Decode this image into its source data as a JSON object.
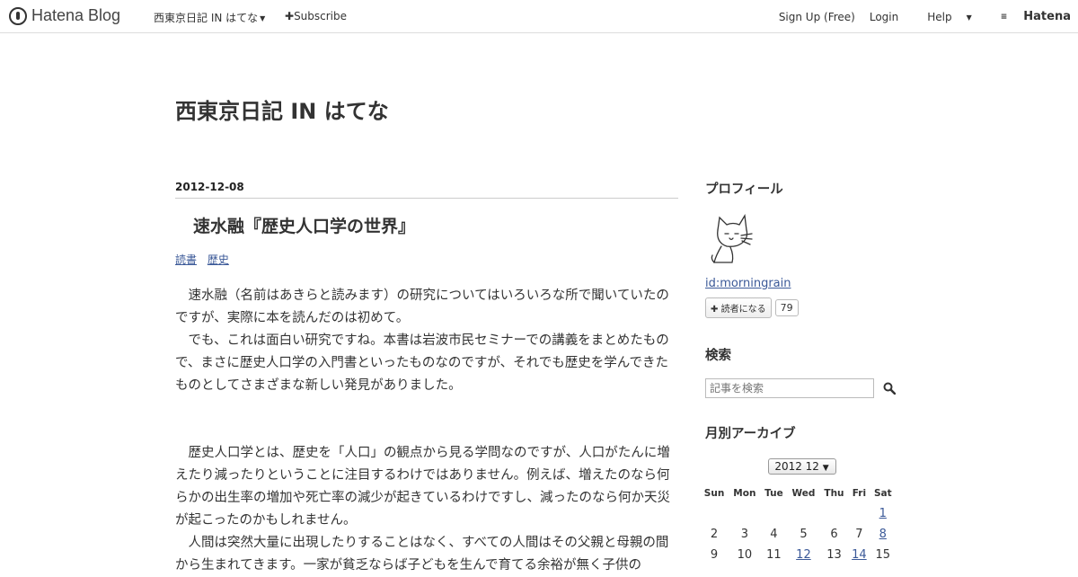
{
  "topbar": {
    "logo": "Hatena Blog",
    "blog_menu": "西東京日記 IN はてな",
    "subscribe": "Subscribe",
    "signup": "Sign Up (Free)",
    "login": "Login",
    "help": "Help",
    "hatena": "Hatena"
  },
  "blog": {
    "title": "西東京日記 IN はてな"
  },
  "entry": {
    "date": "2012-12-08",
    "title": "速水融『歴史人口学の世界』",
    "categories": [
      "読書",
      "歴史"
    ],
    "paragraphs": [
      "　速水融（名前はあきらと読みます）の研究についてはいろいろな所で聞いていたのですが、実際に本を読んだのは初めて。",
      "　でも、これは面白い研究ですね。本書は岩波市民セミナーでの講義をまとめたもので、まさに歴史人口学の入門書といったものなのですが、それでも歴史を学んできたものとしてさまざまな新しい発見がありました。",
      "　歴史人口学とは、歴史を「人口」の観点から見る学問なのですが、人口がたんに増えたり減ったりということに注目するわけではありません。例えば、増えたのなら何らかの出生率の増加や死亡率の減少が起きているわけですし、減ったのなら何か天災が起こったのかもしれません。",
      "　人間は突然大量に出現したりすることはなく、すべての人間はその父親と母親の間から生まれてきます。一家が貧乏ならば子どもを生んで育てる余裕が無く子供の"
    ]
  },
  "sidebar": {
    "profile_heading": "プロフィール",
    "profile_id": "id:morningrain",
    "reader_button": "読者になる",
    "reader_count": "79",
    "search_heading": "検索",
    "search_placeholder": "記事を検索",
    "archive_heading": "月別アーカイブ",
    "archive_selected": "2012 12",
    "calendar": {
      "weekdays": [
        "Sun",
        "Mon",
        "Tue",
        "Wed",
        "Thu",
        "Fri",
        "Sat"
      ],
      "weeks": [
        [
          {
            "d": ""
          },
          {
            "d": ""
          },
          {
            "d": ""
          },
          {
            "d": ""
          },
          {
            "d": ""
          },
          {
            "d": ""
          },
          {
            "d": "1",
            "link": true
          }
        ],
        [
          {
            "d": "2"
          },
          {
            "d": "3"
          },
          {
            "d": "4"
          },
          {
            "d": "5"
          },
          {
            "d": "6"
          },
          {
            "d": "7"
          },
          {
            "d": "8",
            "link": true
          }
        ],
        [
          {
            "d": "9"
          },
          {
            "d": "10"
          },
          {
            "d": "11"
          },
          {
            "d": "12",
            "link": true
          },
          {
            "d": "13"
          },
          {
            "d": "14",
            "link": true
          },
          {
            "d": "15"
          }
        ]
      ]
    }
  }
}
